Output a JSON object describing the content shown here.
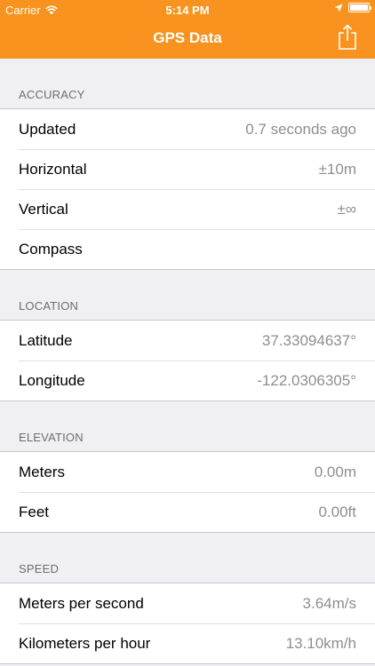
{
  "status_bar": {
    "carrier": "Carrier",
    "time": "5:14 PM"
  },
  "nav": {
    "title": "GPS Data",
    "accent": "#f7931e"
  },
  "sections": [
    {
      "header": "ACCURACY",
      "rows": [
        {
          "label": "Updated",
          "value": "0.7 seconds ago"
        },
        {
          "label": "Horizontal",
          "value": "±10m"
        },
        {
          "label": "Vertical",
          "value": "±∞"
        },
        {
          "label": "Compass",
          "value": ""
        }
      ]
    },
    {
      "header": "LOCATION",
      "rows": [
        {
          "label": "Latitude",
          "value": "37.33094637°"
        },
        {
          "label": "Longitude",
          "value": "-122.0306305°"
        }
      ]
    },
    {
      "header": "ELEVATION",
      "rows": [
        {
          "label": "Meters",
          "value": "0.00m"
        },
        {
          "label": "Feet",
          "value": "0.00ft"
        }
      ]
    },
    {
      "header": "SPEED",
      "rows": [
        {
          "label": "Meters per second",
          "value": "3.64m/s"
        },
        {
          "label": "Kilometers per hour",
          "value": "13.10km/h"
        }
      ]
    }
  ]
}
